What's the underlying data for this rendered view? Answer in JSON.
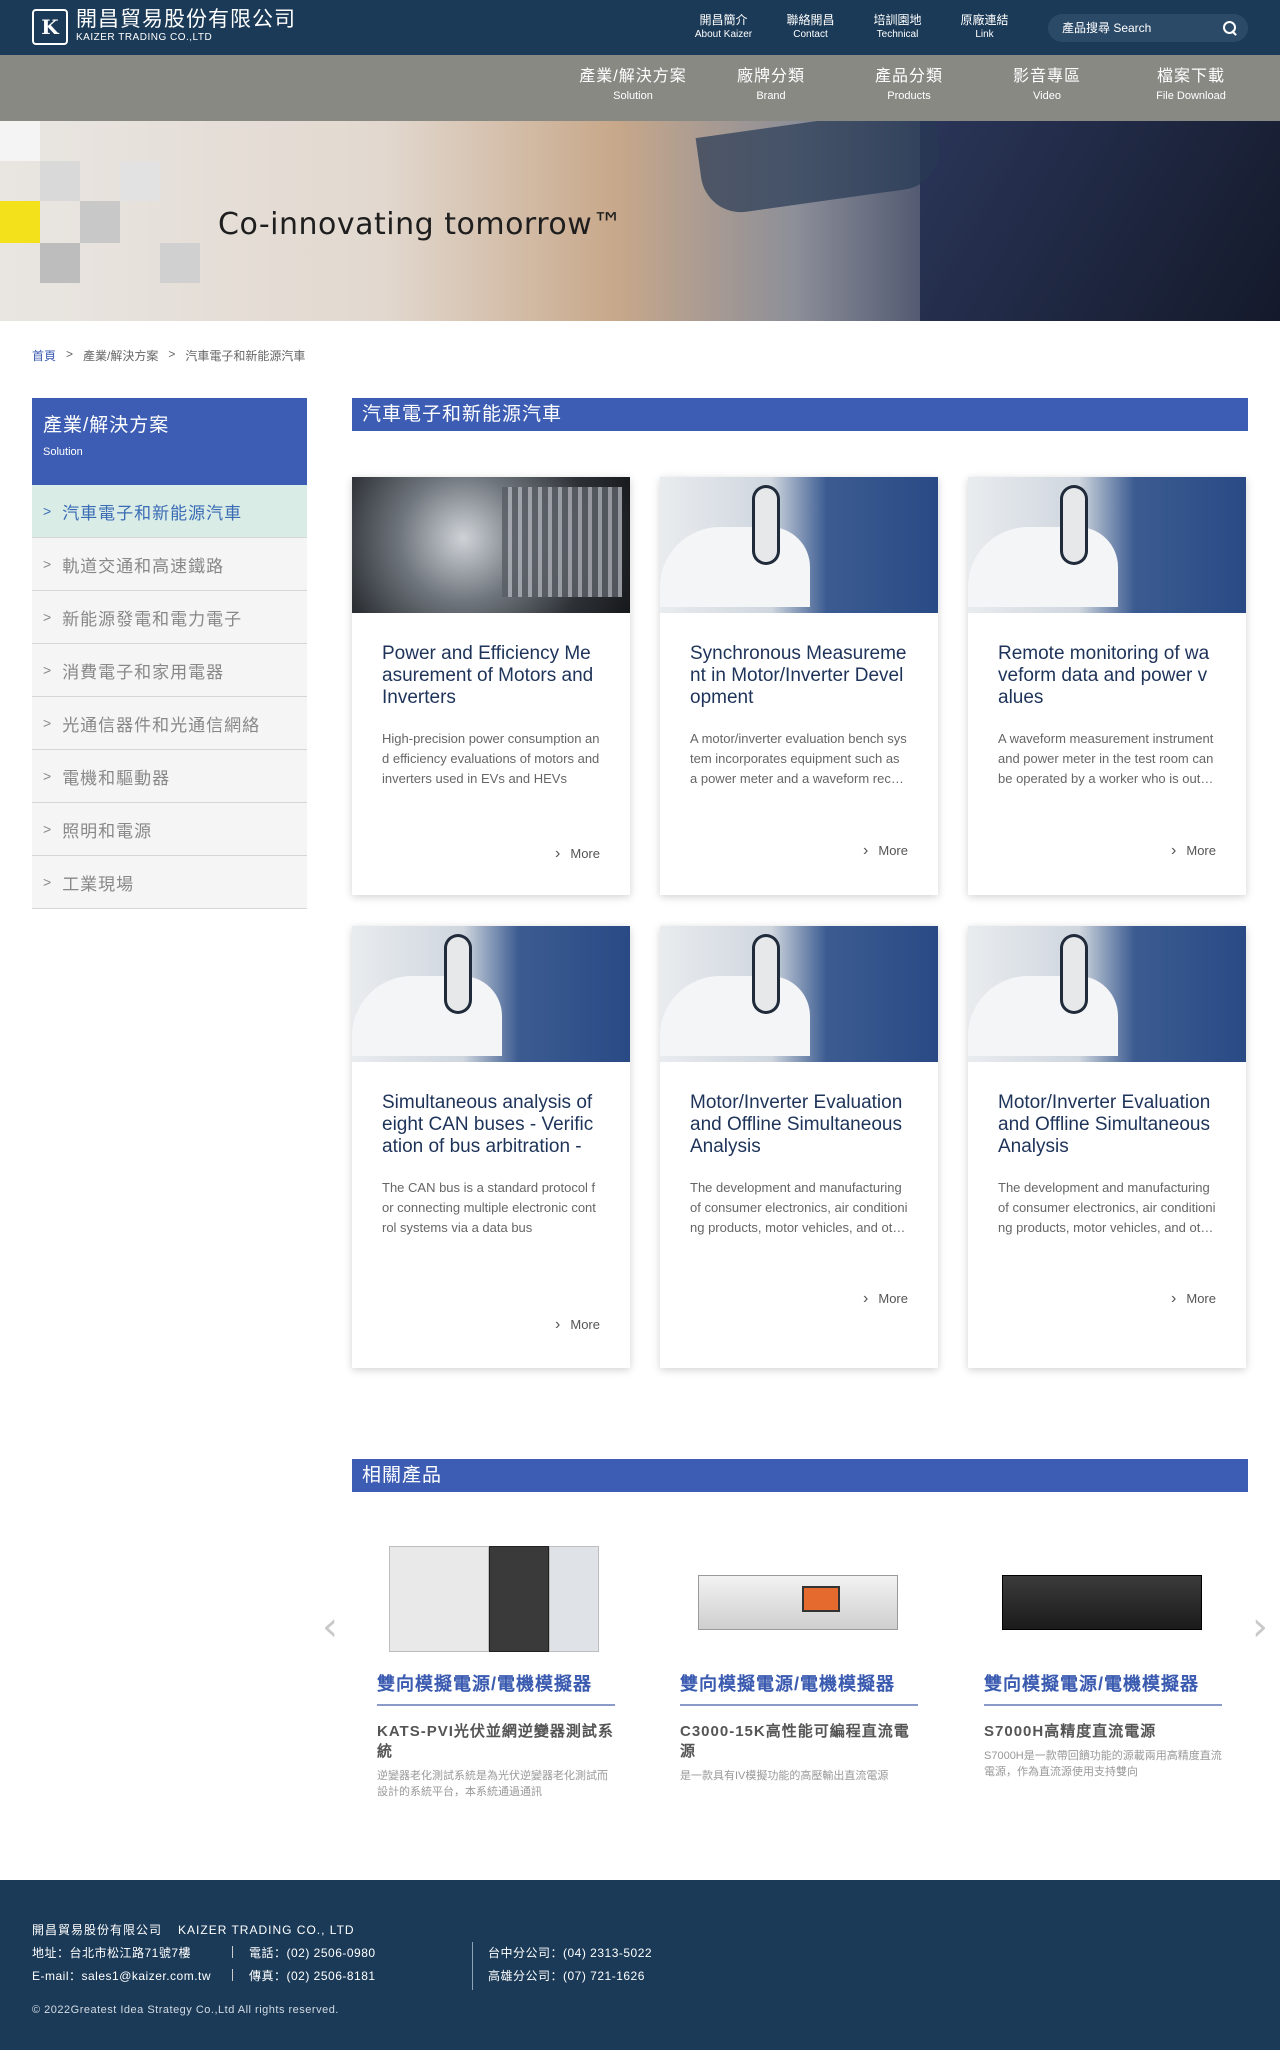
{
  "brand": {
    "logo_mark": "K",
    "name_cn": "開昌貿易股份有限公司",
    "name_en": "KAIZER TRADING CO.,LTD"
  },
  "top_links": [
    {
      "cn": "開昌簡介",
      "en": "About Kaizer"
    },
    {
      "cn": "聯絡開昌",
      "en": "Contact"
    },
    {
      "cn": "培訓園地",
      "en": "Technical"
    },
    {
      "cn": "原廠連結",
      "en": "Link"
    }
  ],
  "search": {
    "placeholder": "產品搜尋 Search",
    "icon": "search-icon"
  },
  "main_nav": [
    {
      "cn": "產業/解決方案",
      "en": "Solution"
    },
    {
      "cn": "廠牌分類",
      "en": "Brand"
    },
    {
      "cn": "產品分類",
      "en": "Products"
    },
    {
      "cn": "影音專區",
      "en": "Video"
    },
    {
      "cn": "檔案下載",
      "en": "File Download"
    }
  ],
  "banner": {
    "slogan": "Co-innovating tomorrow™"
  },
  "breadcrumb": {
    "home": "首頁",
    "sep": ">",
    "level1": "產業/解決方案",
    "current": "汽車電子和新能源汽車"
  },
  "sidebar": {
    "title_cn": "產業/解決方案",
    "title_en": "Solution",
    "chevron": ">",
    "items": [
      {
        "label": "汽車電子和新能源汽車",
        "active": true
      },
      {
        "label": "軌道交通和高速鐵路",
        "active": false
      },
      {
        "label": "新能源發電和電力電子",
        "active": false
      },
      {
        "label": "消費電子和家用電器",
        "active": false
      },
      {
        "label": "光通信器件和光通信網絡",
        "active": false
      },
      {
        "label": "電機和驅動器",
        "active": false
      },
      {
        "label": "照明和電源",
        "active": false
      },
      {
        "label": "工業現場",
        "active": false
      }
    ]
  },
  "section_title": "汽車電子和新能源汽車",
  "cards": [
    {
      "image": "motor",
      "title": "Power and Efficiency Measurement of Motors and Inverters",
      "desc": "High-precision power consumption and efficiency evaluations of motors and inverters used in EVs and HEVs",
      "more": "More"
    },
    {
      "image": "ev-charger",
      "title": "Synchronous Measurement in Motor/Inverter Development",
      "desc": "A motor/inverter evaluation bench system incorporates equipment such as a power meter and a waveform recorder",
      "more": "More"
    },
    {
      "image": "ev-charger",
      "title": "Remote monitoring of waveform data and power values",
      "desc": "A waveform measurement instrument and power meter in the test room can be operated by a worker who is outside",
      "more": "More"
    },
    {
      "image": "ev-charger",
      "title": "Simultaneous analysis of eight CAN buses - Verification of bus arbitration -",
      "desc": "The CAN bus is a standard protocol for connecting multiple electronic control systems via a data bus",
      "more": "More"
    },
    {
      "image": "ev-charger",
      "title": "Motor/Inverter Evaluation and Offline Simultaneous Analysis",
      "desc": "The development and manufacturing of consumer electronics, air conditioning products, motor vehicles, and other products",
      "more": "More"
    },
    {
      "image": "ev-charger",
      "title": "Motor/Inverter Evaluation and Offline Simultaneous Analysis",
      "desc": "The development and manufacturing of consumer electronics, air conditioning products, motor vehicles, and other products",
      "more": "More"
    }
  ],
  "related": {
    "title": "相關產品",
    "prev_icon": "‹",
    "next_icon": "›",
    "products": [
      {
        "category": "雙向模擬電源/電機模擬器",
        "name": "KATS-PVI光伏並網逆變器測試系統",
        "desc": "逆變器老化測試系統是為光伏逆變器老化測試而設計的系統平台，本系統通過通訊"
      },
      {
        "category": "雙向模擬電源/電機模擬器",
        "name": "C3000-15K高性能可編程直流電源",
        "desc": "是一款具有IV模擬功能的高壓輸出直流電源"
      },
      {
        "category": "雙向模擬電源/電機模擬器",
        "name": "S7000H高精度直流電源",
        "desc": "S7000H是一款帶回饋功能的源載兩用高精度直流電源，作為直流源使用支持雙向"
      }
    ]
  },
  "footer": {
    "company_cn": "開昌貿易股份有限公司",
    "company_en": "KAIZER TRADING CO., LTD",
    "address": "地址：台北市松江路71號7樓",
    "phone": "電話：(02) 2506-0980",
    "email": "E-mail：sales1@kaizer.com.tw",
    "fax": "傳真：(02) 2506-8181",
    "taichung": "台中分公司：(04) 2313-5022",
    "kaohsiung": "高雄分公司：(07) 721-1626",
    "copyright": "© 2022Greatest Idea Strategy Co.,Ltd All rights reserved."
  },
  "colors": {
    "header": "#1b3a57",
    "nav": "#898984",
    "accent": "#3c5db3",
    "active_bg": "#d9ece6"
  }
}
